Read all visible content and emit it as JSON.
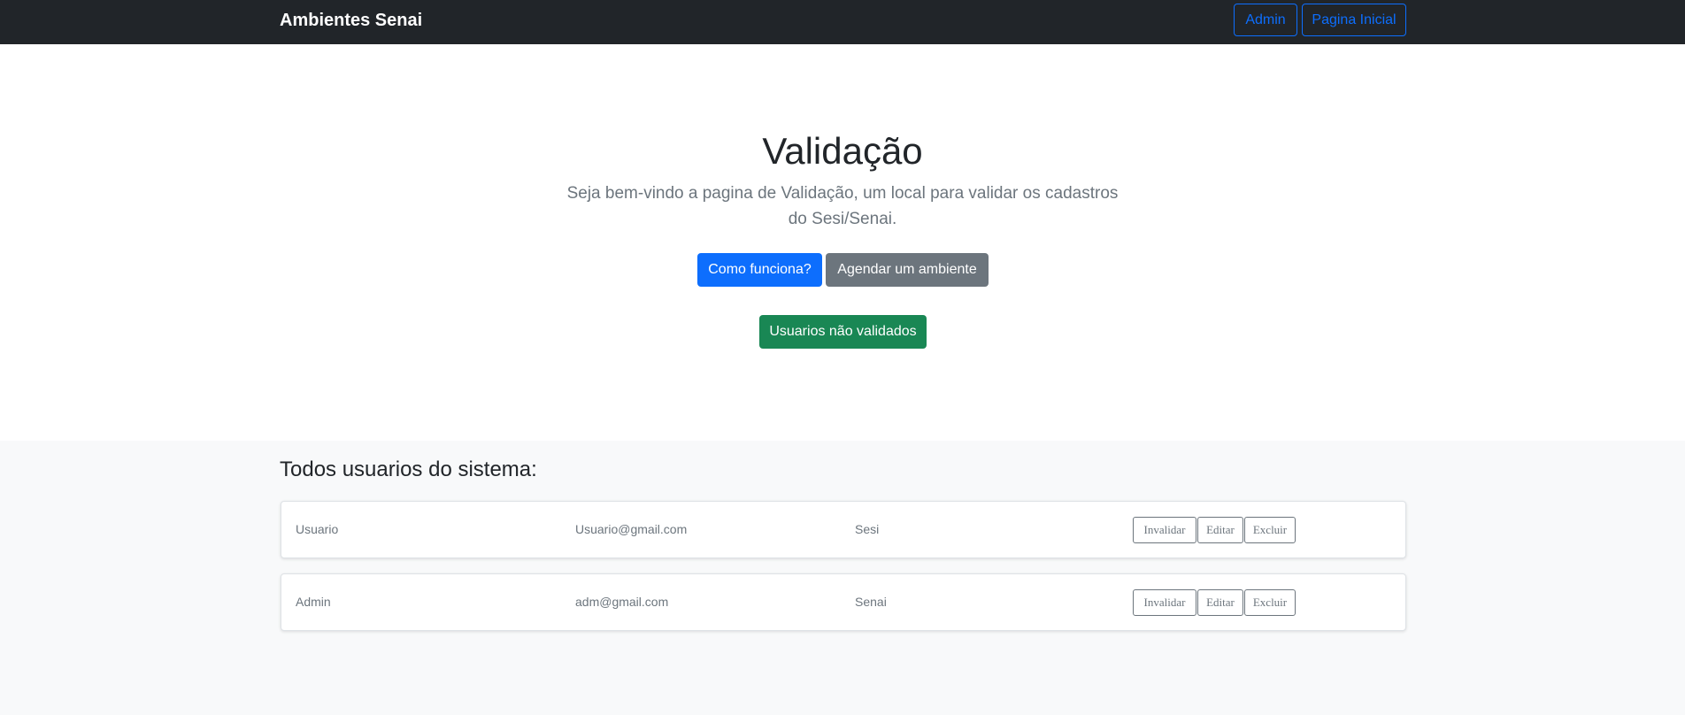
{
  "navbar": {
    "brand": "Ambientes Senai",
    "admin_label": "Admin",
    "home_label": "Pagina Inicial",
    "accent_color": "#0d6efd",
    "background_color": "#212529"
  },
  "hero": {
    "title": "Validação",
    "lead": "Seja bem-vindo a pagina de Validação, um local para validar os cadastros do Sesi/Senai.",
    "primary_button": "Como funciona?",
    "secondary_button": "Agendar um ambiente",
    "success_button": "Usuarios não validados"
  },
  "users": {
    "title": "Todos usuarios do sistema:",
    "rows": [
      {
        "name": "Usuario",
        "email": "Usuario@gmail.com",
        "org": "Sesi",
        "actions": [
          "Invalidar",
          "Editar",
          "Excluir"
        ]
      },
      {
        "name": "Admin",
        "email": "adm@gmail.com",
        "org": "Senai",
        "actions": [
          "Invalidar",
          "Editar",
          "Excluir"
        ]
      }
    ]
  }
}
